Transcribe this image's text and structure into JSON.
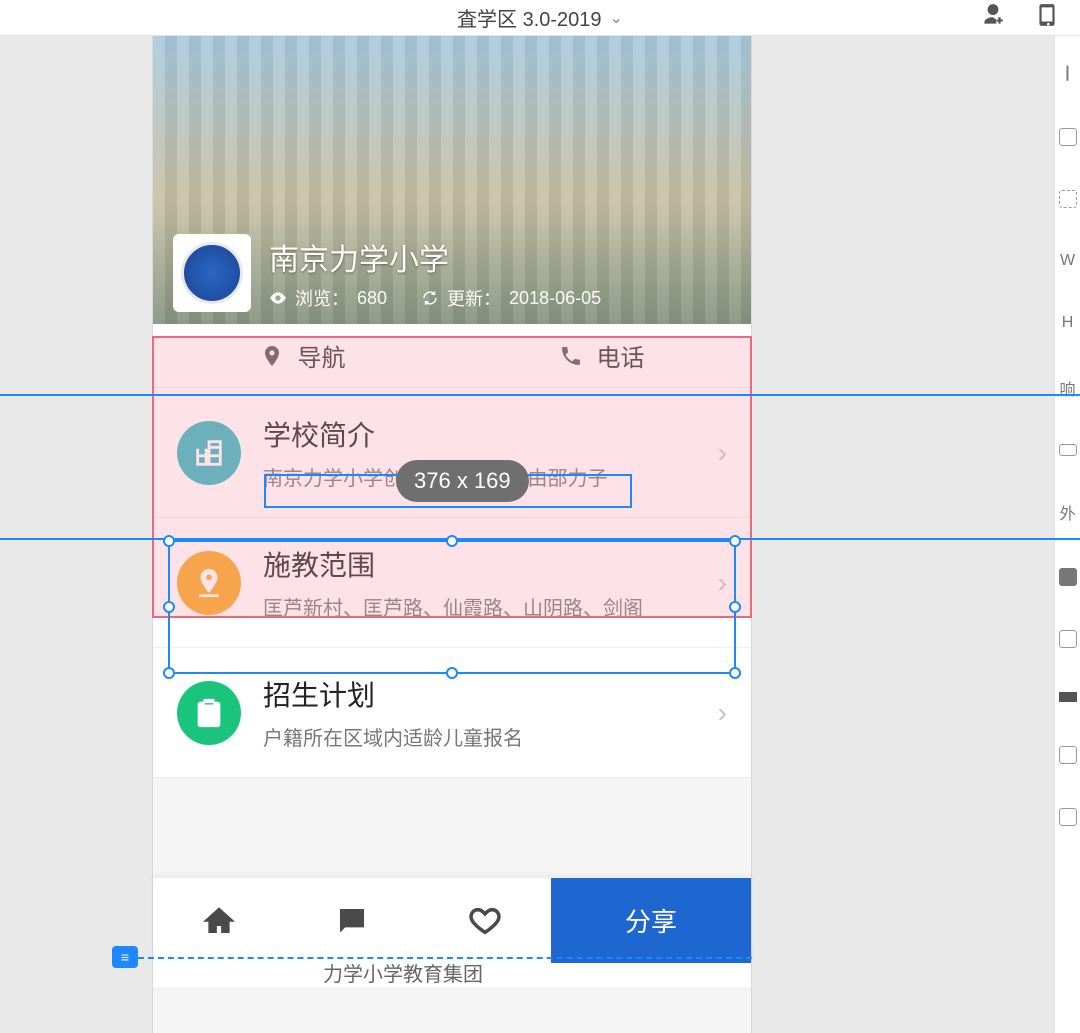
{
  "toolbar": {
    "project_title": "査学区 3.0-2019"
  },
  "rightPanel": {
    "labels": [
      "W",
      "H",
      "响",
      "外"
    ]
  },
  "header": {
    "school_name": "南京力学小学",
    "views_label": "浏览：",
    "views_count": "680",
    "updated_label": "更新：",
    "updated_date": "2018-06-05"
  },
  "actions": {
    "nav_label": "导航",
    "phone_label": "电话"
  },
  "items": [
    {
      "title": "学校简介",
      "sub": "南京力学小学创建于1947年，由邵力子"
    },
    {
      "title": "施教范围",
      "sub": "匡芦新村、匡芦路、仙霞路、山阴路、剑阁"
    },
    {
      "title": "招生计划",
      "sub": "户籍所在区域内适龄儿童报名"
    }
  ],
  "clipped_row_text": "力学小学教育集团",
  "bottom": {
    "share_label": "分享"
  },
  "design": {
    "size_pill": "376 x 169"
  }
}
